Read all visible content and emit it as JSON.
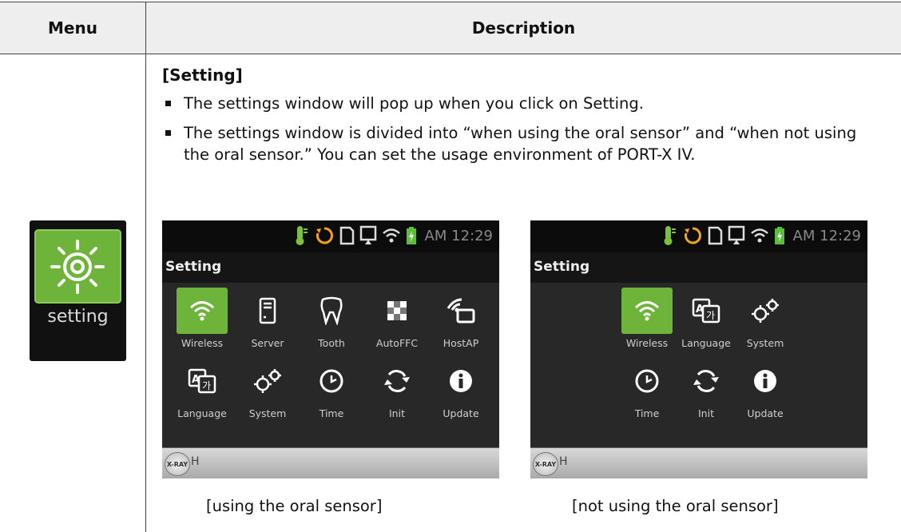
{
  "table": {
    "header_menu": "Menu",
    "header_description": "Description"
  },
  "menu_icon": {
    "icon": "gear-icon",
    "label": "setting"
  },
  "section_title": "[Setting]",
  "bullets": [
    "The settings window will pop up when you click on Setting.",
    "The settings window is divided into “when using the oral sensor” and “when not using the oral sensor.” You can set the usage environment of PORT-X IV."
  ],
  "screens": [
    {
      "clock": "AM 12:29",
      "title": "Setting",
      "apps": [
        {
          "label": "Wireless",
          "icon": "wifi-icon",
          "selected": true
        },
        {
          "label": "Server",
          "icon": "server-icon",
          "selected": false
        },
        {
          "label": "Tooth",
          "icon": "tooth-icon",
          "selected": false
        },
        {
          "label": "AutoFFC",
          "icon": "autoffc-icon",
          "selected": false
        },
        {
          "label": "HostAP",
          "icon": "hostap-icon",
          "selected": false
        },
        {
          "label": "Language",
          "icon": "language-icon",
          "selected": false
        },
        {
          "label": "System",
          "icon": "system-gears-icon",
          "selected": false
        },
        {
          "label": "Time",
          "icon": "clock-icon",
          "selected": false
        },
        {
          "label": "Init",
          "icon": "init-icon",
          "selected": false
        },
        {
          "label": "Update",
          "icon": "info-icon",
          "selected": false
        }
      ],
      "xray_badge": "X-RAY",
      "xray_status": "H",
      "caption": "[using the oral sensor]"
    },
    {
      "clock": "AM 12:29",
      "title": "Setting",
      "apps": [
        {
          "label": "Wireless",
          "icon": "wifi-icon",
          "selected": true
        },
        {
          "label": "Language",
          "icon": "language-icon",
          "selected": false
        },
        {
          "label": "System",
          "icon": "system-gears-icon",
          "selected": false
        },
        {
          "label": "Time",
          "icon": "clock-icon",
          "selected": false
        },
        {
          "label": "Init",
          "icon": "init-icon",
          "selected": false
        },
        {
          "label": "Update",
          "icon": "info-icon",
          "selected": false
        }
      ],
      "xray_badge": "X-RAY",
      "xray_status": "H",
      "caption": "[not using the oral sensor]"
    }
  ],
  "colors": {
    "accent_green": "#6fb43a",
    "screen_bg": "#282828",
    "status_bar": "#0c0c0c"
  }
}
